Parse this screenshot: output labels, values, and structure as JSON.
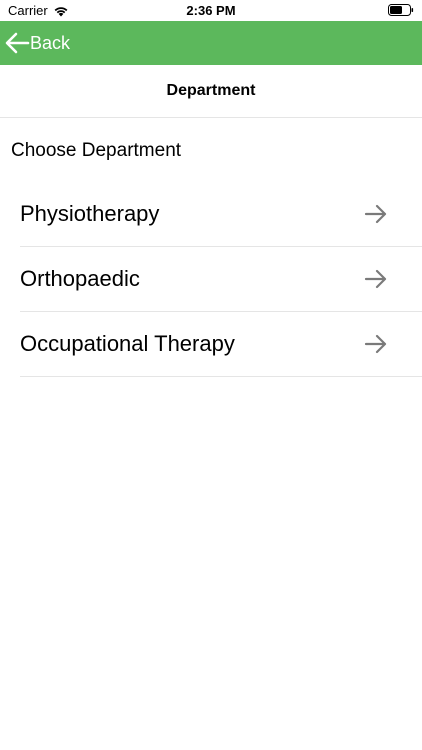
{
  "status_bar": {
    "carrier": "Carrier",
    "time": "2:36 PM"
  },
  "nav_bar": {
    "back_label": "Back",
    "color": "#5cb85c"
  },
  "header": {
    "title": "Department"
  },
  "section": {
    "label": "Choose Department"
  },
  "departments": [
    {
      "label": "Physiotherapy",
      "icon": "arrow-right-icon"
    },
    {
      "label": "Orthopaedic",
      "icon": "arrow-right-icon"
    },
    {
      "label": "Occupational Therapy",
      "icon": "arrow-right-icon"
    }
  ]
}
